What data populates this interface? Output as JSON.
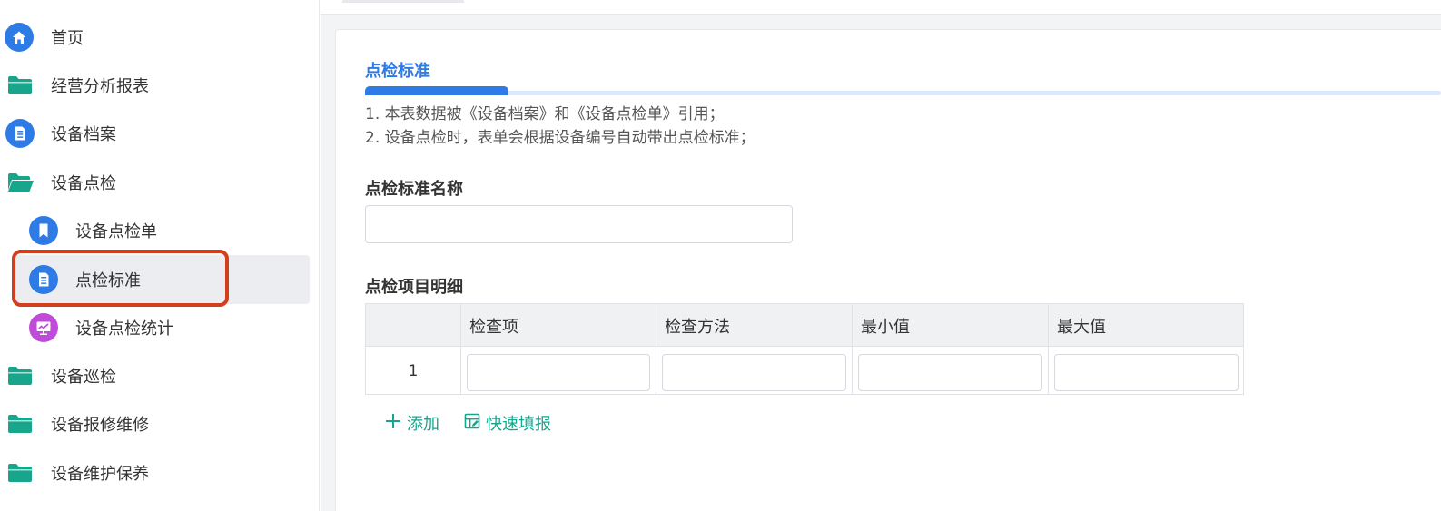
{
  "sidebar": {
    "items": [
      {
        "label": "首页",
        "icon": "home-icon"
      },
      {
        "label": "经营分析报表",
        "icon": "folder-icon"
      },
      {
        "label": "设备档案",
        "icon": "document-icon"
      },
      {
        "label": "设备点检",
        "icon": "folder-open-icon"
      },
      {
        "label": "设备点检单",
        "icon": "bookmark-icon"
      },
      {
        "label": "点检标准",
        "icon": "document-icon"
      },
      {
        "label": "设备点检统计",
        "icon": "chart-monitor-icon"
      },
      {
        "label": "设备巡检",
        "icon": "folder-icon"
      },
      {
        "label": "设备报修维修",
        "icon": "folder-icon"
      },
      {
        "label": "设备维护保养",
        "icon": "folder-icon"
      }
    ],
    "selected": "点检标准"
  },
  "colors": {
    "accent_blue": "#2e7be6",
    "folder_teal": "#17a58c",
    "purple": "#c04ad9",
    "highlight_red": "#d23f1f"
  },
  "form": {
    "section_title": "点检标准",
    "notes": [
      "1. 本表数据被《设备档案》和《设备点检单》引用；",
      "2. 设备点检时，表单会根据设备编号自动带出点检标准；"
    ],
    "name_label": "点检标准名称",
    "name_value": "",
    "detail_label": "点检项目明细",
    "table": {
      "headers": [
        "检查项",
        "检查方法",
        "最小值",
        "最大值"
      ],
      "rows": [
        {
          "index": "1",
          "cells": [
            "",
            "",
            "",
            ""
          ]
        }
      ]
    },
    "actions": {
      "add": "添加",
      "quick_fill": "快速填报"
    }
  }
}
